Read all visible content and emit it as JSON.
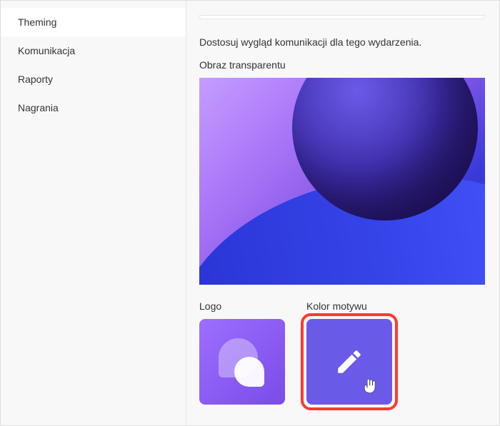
{
  "sidebar": {
    "items": [
      {
        "label": "Theming",
        "active": true
      },
      {
        "label": "Komunikacja",
        "active": false
      },
      {
        "label": "Raporty",
        "active": false
      },
      {
        "label": "Nagrania",
        "active": false
      }
    ]
  },
  "main": {
    "description": "Dostosuj wygląd komunikacji dla tego wydarzenia.",
    "banner_label": "Obraz transparentu",
    "logo_label": "Logo",
    "theme_color_label": "Kolor motywu"
  },
  "colors": {
    "theme_accent": "#6a5ae8",
    "highlight": "#ff3a30"
  }
}
